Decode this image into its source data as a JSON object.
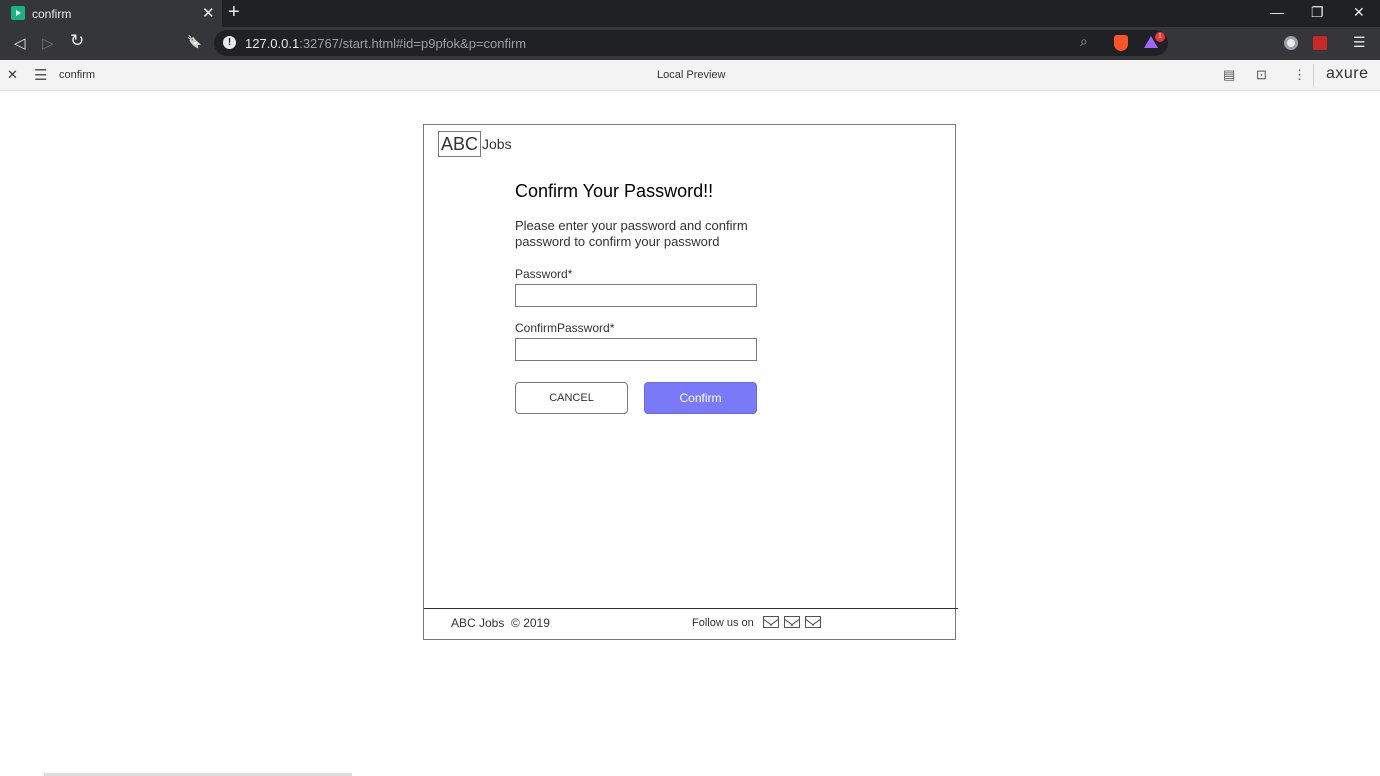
{
  "browser": {
    "tab": {
      "title": "confirm"
    },
    "new_tab": "+",
    "window_controls": {
      "minimize": "—",
      "restore": "❐",
      "close": "✕"
    },
    "tab_close": "✕",
    "nav": {
      "back": "◁",
      "forward": "▷",
      "reload": "↻",
      "bookmark": "🔖"
    },
    "address": {
      "info": "!",
      "host": "127.0.0.1",
      "rest": ":32767/start.html#id=p9pfok&p=confirm"
    },
    "rewards_badge": "1",
    "menu": "☰"
  },
  "axure": {
    "close": "✕",
    "menu": "☰",
    "page_name": "confirm",
    "preview_label": "Local Preview",
    "tools": {
      "notes": "▤",
      "inspect": "⊡",
      "more": "⋮"
    },
    "logo": "axure"
  },
  "page": {
    "logo_abc": "ABC",
    "logo_jobs": "Jobs",
    "heading": "Confirm Your Password!!",
    "description": "Please enter your password and confirm password to confirm your password",
    "password_label": "Password*",
    "password_value": "",
    "confirm_label": "ConfirmPassword*",
    "confirm_value": "",
    "cancel_label": "CANCEL",
    "confirm_button_label": "Confirm",
    "footer_copy": "ABC Jobs  © 2019",
    "footer_follow": "Follow us on"
  },
  "colors": {
    "confirm_button": "#7a7af9",
    "browser_dark": "#202124",
    "browser_toolbar": "#35363a"
  }
}
